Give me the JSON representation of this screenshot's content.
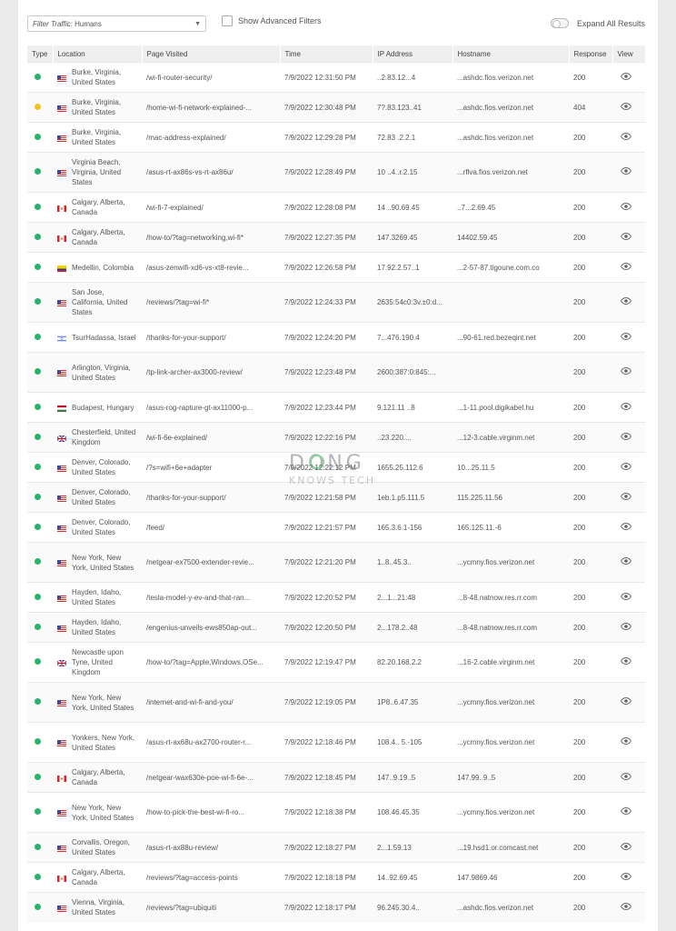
{
  "toolbar": {
    "filter_label": "Filter Traffic:",
    "filter_value": "Humans",
    "advanced_label": "Show Advanced Filters",
    "expand_label": "Expand All Results"
  },
  "columns": [
    "Type",
    "Location",
    "Page Visited",
    "Time",
    "IP Address",
    "Hostname",
    "Response",
    "View"
  ],
  "colors": {
    "ok": "#26b36a",
    "warn": "#f0c419"
  },
  "rows": [
    {
      "status": "ok",
      "flag": "us",
      "location": "Burke, Virginia, United States",
      "page": "/wi-fi-router-security/",
      "time": "7/9/2022 12:31:50 PM",
      "ip": "..2.83.12...4",
      "host": "...ashdc.fios.verizon.net",
      "response": "200",
      "lines": 2
    },
    {
      "status": "warn",
      "flag": "us",
      "location": "Burke, Virginia, United States",
      "page": "/home-wi-fi-network-explained-...",
      "time": "7/9/2022 12:30:48 PM",
      "ip": "7?.83.123..41",
      "host": "...ashdc.fios.verizon.net",
      "response": "404",
      "lines": 2
    },
    {
      "status": "ok",
      "flag": "us",
      "location": "Burke, Virginia, United States",
      "page": "/mac-address-explained/",
      "time": "7/9/2022 12:29:28 PM",
      "ip": "72.83 .2.2.1",
      "host": "...ashdc.fios.verizon.net",
      "response": "200",
      "lines": 2
    },
    {
      "status": "ok",
      "flag": "us",
      "location": "Virginia Beach, Virginia, United States",
      "page": "/asus-rt-ax86s-vs-rt-ax86u/",
      "time": "7/9/2022 12:28:49 PM",
      "ip": "10 ..4..r.2.15",
      "host": "...rflva.fios.verizon.net",
      "response": "200",
      "lines": 3
    },
    {
      "status": "ok",
      "flag": "ca",
      "location": "Calgary, Alberta, Canada",
      "page": "/wi-fi-7-explained/",
      "time": "7/9/2022 12:28:08 PM",
      "ip": "14 ..90.69.45",
      "host": "..7...2.69.45",
      "response": "200",
      "lines": 2
    },
    {
      "status": "ok",
      "flag": "ca",
      "location": "Calgary, Alberta, Canada",
      "page": "/how-to/?tag=networking,wi-fi*",
      "time": "7/9/2022 12:27:35 PM",
      "ip": "147.3269.45",
      "host": "14402.59.45",
      "response": "200",
      "lines": 2
    },
    {
      "status": "ok",
      "flag": "co",
      "location": "Medellin, Colombia",
      "page": "/asus-zenwifi-xd6-vs-xt8-revie...",
      "time": "7/9/2022 12:26:58 PM",
      "ip": "17.92.2.57..1",
      "host": "...2-57-87.tigoune.com.co",
      "response": "200",
      "lines": 2
    },
    {
      "status": "ok",
      "flag": "us",
      "location": "San Jose, California, United States",
      "page": "/reviews/?tag=wi-fi*",
      "time": "7/9/2022 12:24:33 PM",
      "ip": "2635:54c0:3v.±0:d...",
      "host": "",
      "response": "200",
      "lines": 3
    },
    {
      "status": "ok",
      "flag": "il",
      "location": "TsurHadassa, Israel",
      "page": "/thanks-for-your-support/",
      "time": "7/9/2022 12:24:20 PM",
      "ip": "7...476.190.4",
      "host": "...90-61.red.bezeqint.net",
      "response": "200",
      "lines": 2
    },
    {
      "status": "ok",
      "flag": "us",
      "location": "Arlington, Virginia, United States",
      "page": "/tp-link-archer-ax3000-review/",
      "time": "7/9/2022 12:23:48 PM",
      "ip": "2600:387:0:845:...",
      "host": "",
      "response": "200",
      "lines": 3
    },
    {
      "status": "ok",
      "flag": "hu",
      "location": "Budapest, Hungary",
      "page": "/asus-rog-rapture-gt-ax11000-p...",
      "time": "7/9/2022 12:23:44 PM",
      "ip": "9.121.11 ..8",
      "host": "...1-11.pool.digikabel.hu",
      "response": "200",
      "lines": 2
    },
    {
      "status": "ok",
      "flag": "gb",
      "location": "Chesterfield, United Kingdom",
      "page": "/wi-fi-6e-explained/",
      "time": "7/9/2022 12:22:16 PM",
      "ip": "..23.220....",
      "host": "...12-3.cable.virginm.net",
      "response": "200",
      "lines": 2
    },
    {
      "status": "ok",
      "flag": "us",
      "location": "Denver, Colorado, United States",
      "page": "/?s=wifi+6e+adapter",
      "time": "7/9/2022 12:22:12 PM",
      "ip": "1655.25.112.6",
      "host": "10...25.11.5",
      "response": "200",
      "lines": 2
    },
    {
      "status": "ok",
      "flag": "us",
      "location": "Denver, Colorado, United States",
      "page": "/thanks-for-your-support/",
      "time": "7/9/2022 12:21:58 PM",
      "ip": "1eb.1.p5.111.5",
      "host": "115.225.11.56",
      "response": "200",
      "lines": 2
    },
    {
      "status": "ok",
      "flag": "us",
      "location": "Denver, Colorado, United States",
      "page": "/feed/",
      "time": "7/9/2022 12:21:57 PM",
      "ip": "165.3.6.1-156",
      "host": "165.125.11.-6",
      "response": "200",
      "lines": 2
    },
    {
      "status": "ok",
      "flag": "us",
      "location": "New York, New York, United States",
      "page": "/netgear-ex7500-extender-revie...",
      "time": "7/9/2022 12:21:20 PM",
      "ip": "1..8..45.3..",
      "host": "...ycmny.fios.verizon.net",
      "response": "200",
      "lines": 3
    },
    {
      "status": "ok",
      "flag": "us",
      "location": "Hayden, Idaho, United States",
      "page": "/tesla-model-y-ev-and-that-ran...",
      "time": "7/9/2022 12:20:52 PM",
      "ip": "2...1...21:48",
      "host": "...8-48.natnow.res.rr.com",
      "response": "200",
      "lines": 2
    },
    {
      "status": "ok",
      "flag": "us",
      "location": "Hayden, Idaho, United States",
      "page": "/engenius-unveils-ews850ap-out...",
      "time": "7/9/2022 12:20:50 PM",
      "ip": "2...178.2..48",
      "host": "...8-48.natnow.res.rr.com",
      "response": "200",
      "lines": 2
    },
    {
      "status": "ok",
      "flag": "gb",
      "location": "Newcastle upon Tyne, United Kingdom",
      "page": "/how-to/?tag=Apple,Windows,OSe...",
      "time": "7/9/2022 12:19:47 PM",
      "ip": "82.20.168.2.2",
      "host": "...16-2.cable.virginm.net",
      "response": "200",
      "lines": 3
    },
    {
      "status": "ok",
      "flag": "us",
      "location": "New York, New York, United States",
      "page": "/internet-and-wi-fi-and-you/",
      "time": "7/9/2022 12:19:05 PM",
      "ip": "1P8..6.47.35",
      "host": "...ycmny.fios.verizon.net",
      "response": "200",
      "lines": 3
    },
    {
      "status": "ok",
      "flag": "us",
      "location": "Yonkers, New York, United States",
      "page": "/asus-rt-ax68u-ax2700-router-r...",
      "time": "7/9/2022 12:18:46 PM",
      "ip": "108.4.. 5.-105",
      "host": "...ycmny.fios.verizon.net",
      "response": "200",
      "lines": 3
    },
    {
      "status": "ok",
      "flag": "ca",
      "location": "Calgary, Alberta, Canada",
      "page": "/netgear-wax630e-poe-wi-fi-6e-...",
      "time": "7/9/2022 12:18:45 PM",
      "ip": "147..9.19..5",
      "host": "147.99..9..5",
      "response": "200",
      "lines": 2
    },
    {
      "status": "ok",
      "flag": "us",
      "location": "New York, New York, United States",
      "page": "/how-to-pick-the-best-wi-fi-ro...",
      "time": "7/9/2022 12:18:38 PM",
      "ip": "108.46.45.35",
      "host": "...ycmny.fios.verizon.net",
      "response": "200",
      "lines": 3
    },
    {
      "status": "ok",
      "flag": "us",
      "location": "Corvallis, Oregon, United States",
      "page": "/asus-rt-ax88u-review/",
      "time": "7/9/2022 12:18:27 PM",
      "ip": "2...1.59.13",
      "host": "...19.hsd1.or.comcast.net",
      "response": "200",
      "lines": 2
    },
    {
      "status": "ok",
      "flag": "ca",
      "location": "Calgary, Alberta, Canada",
      "page": "/reviews/?tag=access-points",
      "time": "7/9/2022 12:18:18 PM",
      "ip": "14..92.69.45",
      "host": "147.9869.46",
      "response": "200",
      "lines": 2
    },
    {
      "status": "ok",
      "flag": "us",
      "location": "Vienna, Virginia, United States",
      "page": "/reviews/?tag=ubiquiti",
      "time": "7/9/2022 12:18:17 PM",
      "ip": "96.245.30.4..",
      "host": "...ashdc.fios.verizon.net",
      "response": "200",
      "lines": 2
    }
  ]
}
